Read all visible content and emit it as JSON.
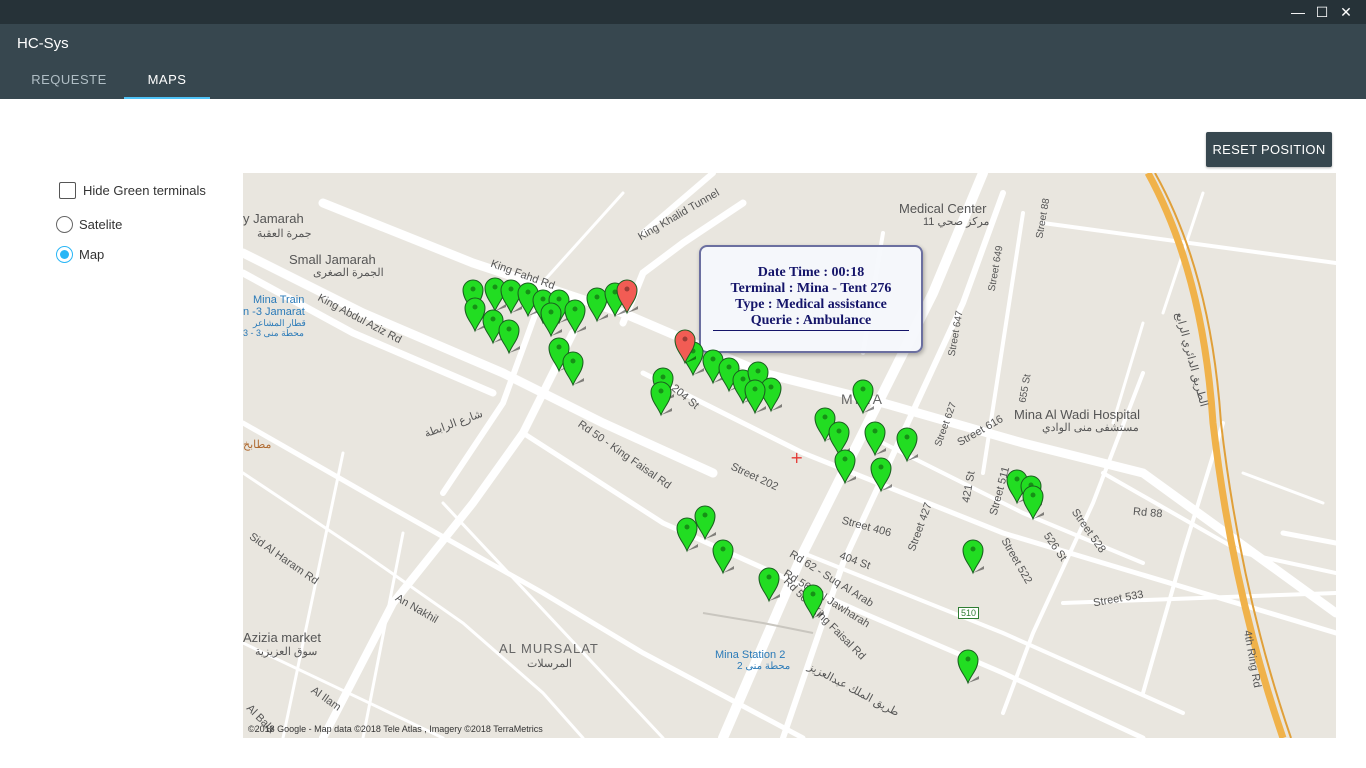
{
  "window": {
    "title": "HC-Sys",
    "controls": {
      "minimize": "—",
      "maximize": "☐",
      "close": "✕"
    }
  },
  "tabs": [
    {
      "label": "REQUESTE"
    },
    {
      "label": "MAPS"
    }
  ],
  "controls": {
    "hide_green": "Hide Green terminals",
    "satelite": "Satelite",
    "map": "Map",
    "reset": "RESET POSITION"
  },
  "colors": {
    "accent": "#4fc3f7",
    "appbar": "#37474f",
    "titlebar": "#263238",
    "green_marker": "#22dd22",
    "red_marker": "#f25c54"
  },
  "info_window": {
    "line1": "Date Time : 00:18",
    "line2": "Terminal : Mina - Tent 276",
    "line3": "Type : Medical assistance",
    "line4": "Querie : Ambulance"
  },
  "map_labels": {
    "jamarah": "y Jamarah",
    "jamarah_ar": "جمرة العقبة",
    "small_jamarah": "Small Jamarah",
    "small_jamarah_ar": "الجمرة الصغرى",
    "king_fahd_rd": "King Fahd Rd",
    "king_khalid_tunnel": "King Khalid Tunnel",
    "mina_train": "Mina Train",
    "mina_train2": "n -3 Jamarat",
    "mina_train3": "قطار المشاعر",
    "mina_train4": "محطة منى 3 - 3",
    "king_abdul_aziz": "King Abdul Aziz Rd",
    "medical_center": "Medical Center",
    "medical_center_ar": "11 مركز صحي",
    "mina": "MINA",
    "mina_hospital": "Mina Al Wadi Hospital",
    "mina_hospital_ar": "مستشفى منى الوادي",
    "ring_rd_ar": "الطريق الدائري الرابع",
    "ring_rd": "4th Ring Rd",
    "street_88": "Street 88",
    "street_649": "Street 649",
    "street_647": "Street 647",
    "street_627": "Street 627",
    "street_655": "655 St",
    "street_616": "Street 616",
    "street_202": "Street 202",
    "street_406": "Street 406",
    "street_427": "Street 427",
    "street_421": "421 St",
    "street_511": "Street 511",
    "street_522": "Street 522",
    "street_528": "Street 528",
    "street_533": "Street 533",
    "street_526": "526 St",
    "rd_88": "Rd 88",
    "st_404": "404 St",
    "st_204": "204 St",
    "rd_62": "Rd 62 - Suq Al Arab",
    "rd_56": "Rd 56 - Al Jawharah",
    "rd_50": "Rd 50 - King Faisal Rd",
    "rd_50b": "Rd 50 - King Faisal Rd",
    "al_mursalat": "AL MURSALAT",
    "al_mursalat_ar": "المرسلات",
    "mina_station": "Mina Station 2",
    "mina_station_ar": "محطة منى 2",
    "aziziya": "Azizia market",
    "aziziya_ar": "سوق العزيزية",
    "an_nakhil": "An Nakhil",
    "matabikh": "مطابخ",
    "al_haram": "Sid Al Haram Rd",
    "al_ilam": "Al Ilam",
    "al_bala": "Al Bala",
    "route_510": "510",
    "king_faisal_ar": "طريق الملك عبدالعزيز",
    "ar_rabita": "شارع الرابطة",
    "copyright": "©2018 Google - Map data ©2018 Tele Atlas , Imagery ©2018 TerraMetrics"
  }
}
